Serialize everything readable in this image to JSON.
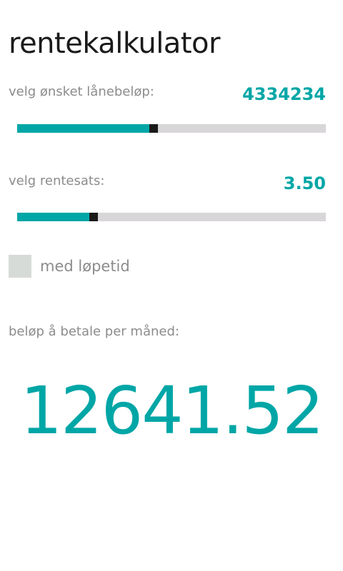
{
  "app": {
    "title": "rentekalkulator"
  },
  "loan": {
    "label": "velg ønsket lånebeløp:",
    "value": "4334234",
    "slider_fraction": 0.44
  },
  "rate": {
    "label": "velg rentesats:",
    "value": "3.50",
    "slider_fraction": 0.24
  },
  "term": {
    "label": "med løpetid",
    "checked": false
  },
  "result": {
    "label": "beløp å betale per måned:",
    "value": "12641.52"
  },
  "colors": {
    "accent": "#00a6a6",
    "track": "#d8d6d8",
    "thumb": "#1a1a1a",
    "checkbox": "#d7dbd8"
  }
}
